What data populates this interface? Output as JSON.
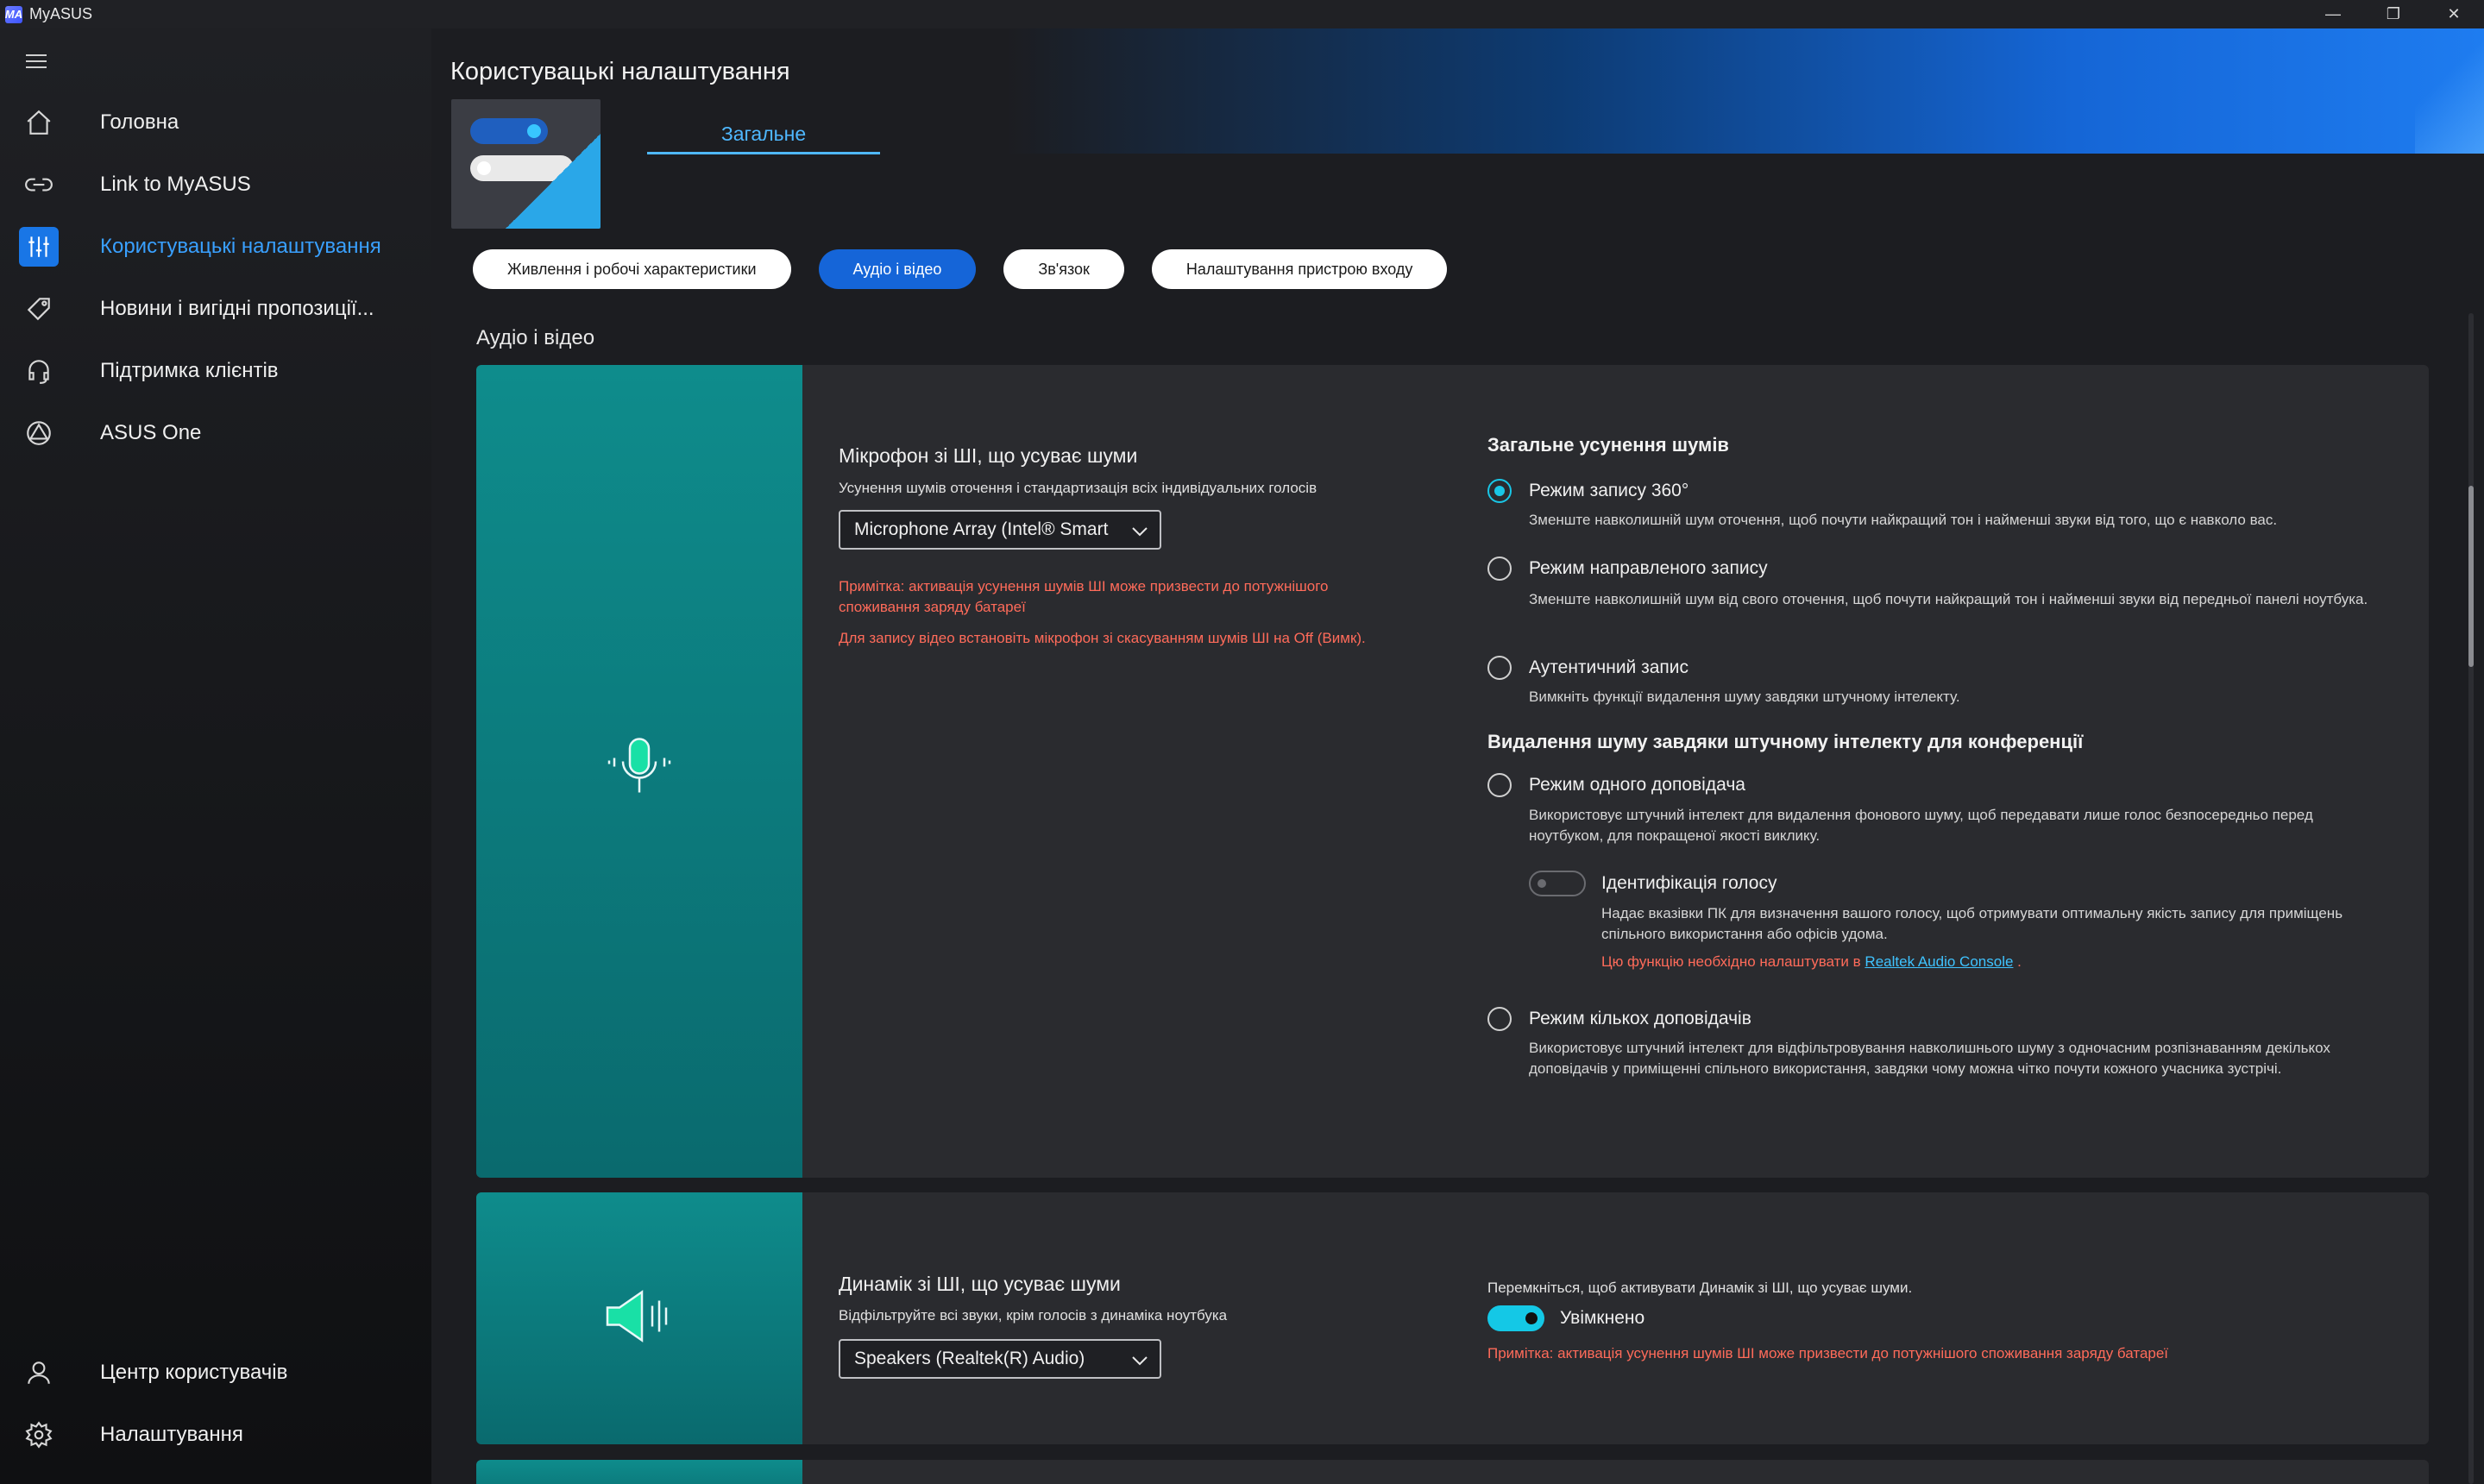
{
  "window": {
    "title": "MyASUS",
    "logo": "MA"
  },
  "sidebar": {
    "items": [
      {
        "label": "Головна",
        "icon": "home-icon"
      },
      {
        "label": "Link to MyASUS",
        "icon": "link-icon"
      },
      {
        "label": "Користувацькі налаштування",
        "icon": "sliders-icon",
        "active": true
      },
      {
        "label": "Новини і вигідні пропозиції...",
        "icon": "tag-icon"
      },
      {
        "label": "Підтримка клієнтів",
        "icon": "headset-icon"
      },
      {
        "label": "ASUS One",
        "icon": "asus-one-icon"
      }
    ],
    "bottom": [
      {
        "label": "Центр користувачів",
        "icon": "user-icon"
      },
      {
        "label": "Налаштування",
        "icon": "gear-icon"
      }
    ]
  },
  "header": {
    "title": "Користувацькі налаштування",
    "tab": "Загальне"
  },
  "pills": [
    "Живлення і робочі характеристики",
    "Аудіо і відео",
    "Зв'язок",
    "Налаштування пристрою входу"
  ],
  "section_title": "Аудіо і відео",
  "mic_card": {
    "title": "Мікрофон зі ШІ, що усуває шуми",
    "subtitle": "Усунення шумів оточення і стандартизація всіх індивідуальних голосів",
    "device": "Microphone Array (Intel® Smart",
    "warn1": "Примітка: активація усунення шумів ШІ може призвести до потужнішого споживання заряду батареї",
    "warn2": "Для запису відео встановіть мікрофон зі скасуванням шумів ШІ на Off (Вимк).",
    "general_heading": "Загальне усунення шумів",
    "opt360": "Режим запису 360°",
    "opt360_desc": "Зменште навколишній шум оточення, щоб почути найкращий тон і найменші звуки від того, що є навколо вас.",
    "optdir": "Режим направленого запису",
    "optdir_desc": "Зменште навколишній шум від свого оточення, щоб почути найкращий тон і найменші звуки від передньої панелі ноутбука.",
    "optauth": "Аутентичний запис",
    "optauth_desc": "Вимкніть функції видалення шуму завдяки штучному інтелекту.",
    "conf_heading": "Видалення шуму завдяки штучному інтелекту для конференції",
    "optsingle": "Режим одного доповідача",
    "optsingle_desc": "Використовує штучний інтелект для видалення фонового шуму, щоб передавати лише голос безпосередньо перед ноутбуком, для покращеної якості виклику.",
    "voiceid": "Ідентифікація голосу",
    "voiceid_desc": "Надає вказівки ПК для визначення вашого голосу, щоб отримувати оптимальну якість запису для приміщень спільного використання або офісів удома.",
    "voiceid_note": "Цю функцію необхідно налаштувати в",
    "voiceid_link": "Realtek Audio Console",
    "voiceid_dot": ".",
    "optmulti": "Режим кількох доповідачів",
    "optmulti_desc": "Використовує штучний інтелект для відфільтровування навколишнього шуму з одночасним розпізнаванням декількох доповідачів у приміщенні спільного використання, завдяки чому можна чітко почути кожного учасника зустрічі."
  },
  "spk_card": {
    "title": "Динамік зі ШІ, що усуває шуми",
    "subtitle": "Відфільтруйте всі звуки, крім голосів з динаміка ноутбука",
    "device": "Speakers (Realtek(R) Audio)",
    "toggle_hint": "Перемкніться, щоб активувати Динамік зі ШІ, що усуває шуми.",
    "toggle_label": "Увімкнено",
    "warn": "Примітка: активація усунення шумів ШІ може призвести до потужнішого споживання заряду батареї"
  },
  "colors": {
    "accent": "#1976e6",
    "teal": "#0e8c8c",
    "warn": "#ff6b5a",
    "radio_on": "#19c6e6"
  }
}
